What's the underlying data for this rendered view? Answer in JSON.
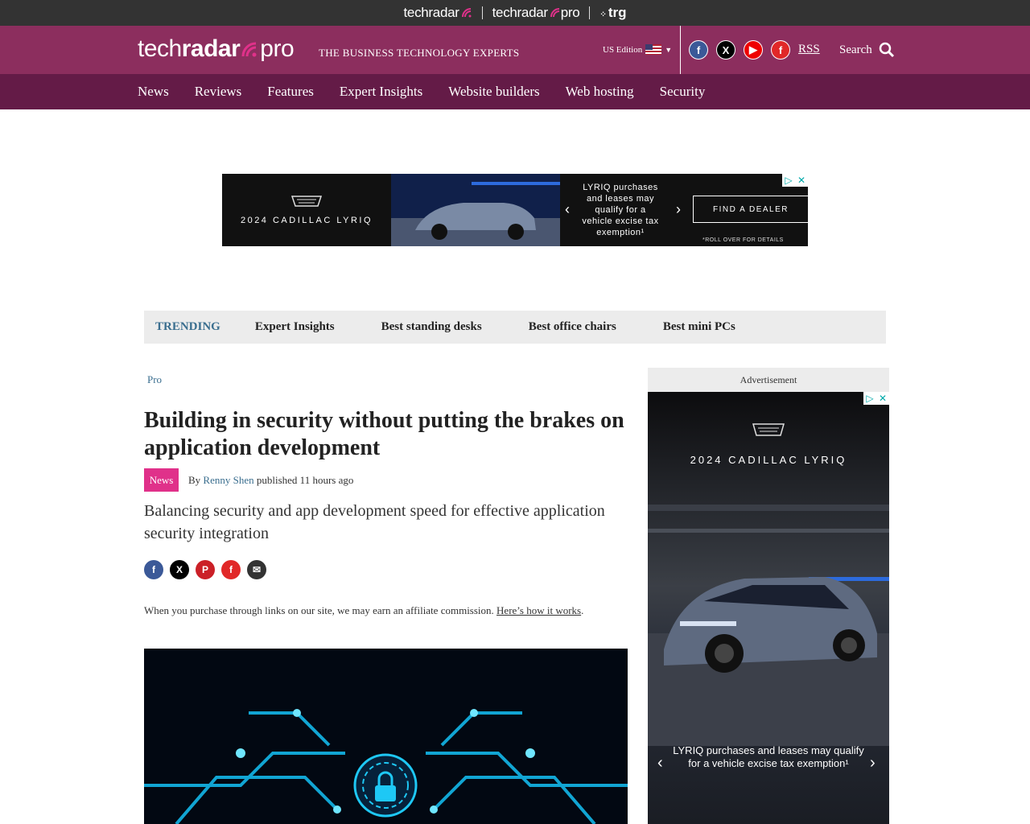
{
  "network_bar": {
    "brand1": "techradar",
    "brand2_a": "techradar",
    "brand2_b": "pro",
    "brand3": "trg"
  },
  "header": {
    "logo_a": "tech",
    "logo_b": "radar",
    "logo_c": "pro",
    "tagline": "THE BUSINESS TECHNOLOGY EXPERTS",
    "edition": "US Edition",
    "rss": "RSS",
    "search": "Search"
  },
  "nav": {
    "items": [
      "News",
      "Reviews",
      "Features",
      "Expert Insights",
      "Website builders",
      "Web hosting",
      "Security"
    ]
  },
  "top_ad": {
    "brand": "2024 CADILLAC LYRIQ",
    "message": "LYRIQ purchases and leases may qualify for a vehicle excise tax exemption¹",
    "cta": "FIND A DEALER",
    "fine_print": "*ROLL OVER FOR DETAILS"
  },
  "trending": {
    "label": "TRENDING",
    "items": [
      "Expert Insights",
      "Best standing desks",
      "Best office chairs",
      "Best mini PCs"
    ]
  },
  "article": {
    "breadcrumb": "Pro",
    "title": "Building in security without putting the brakes on application development",
    "tag": "News",
    "by": "By",
    "author": "Renny Shen",
    "published": "published 11 hours ago",
    "strapline": "Balancing security and app development speed for effective application security integration",
    "disclaimer_text": "When you purchase through links on our site, we may earn an affiliate commission.",
    "disclaimer_link": "Here’s how it works",
    "disclaimer_end": "."
  },
  "sidebar_ad": {
    "label": "Advertisement",
    "brand": "2024 CADILLAC LYRIQ",
    "message": "LYRIQ purchases and leases may qualify for a vehicle excise tax exemption¹"
  },
  "colors": {
    "header": "#8c2e5e",
    "nav": "#641b47",
    "tag": "#e0318a",
    "link": "#3a6e8f"
  }
}
